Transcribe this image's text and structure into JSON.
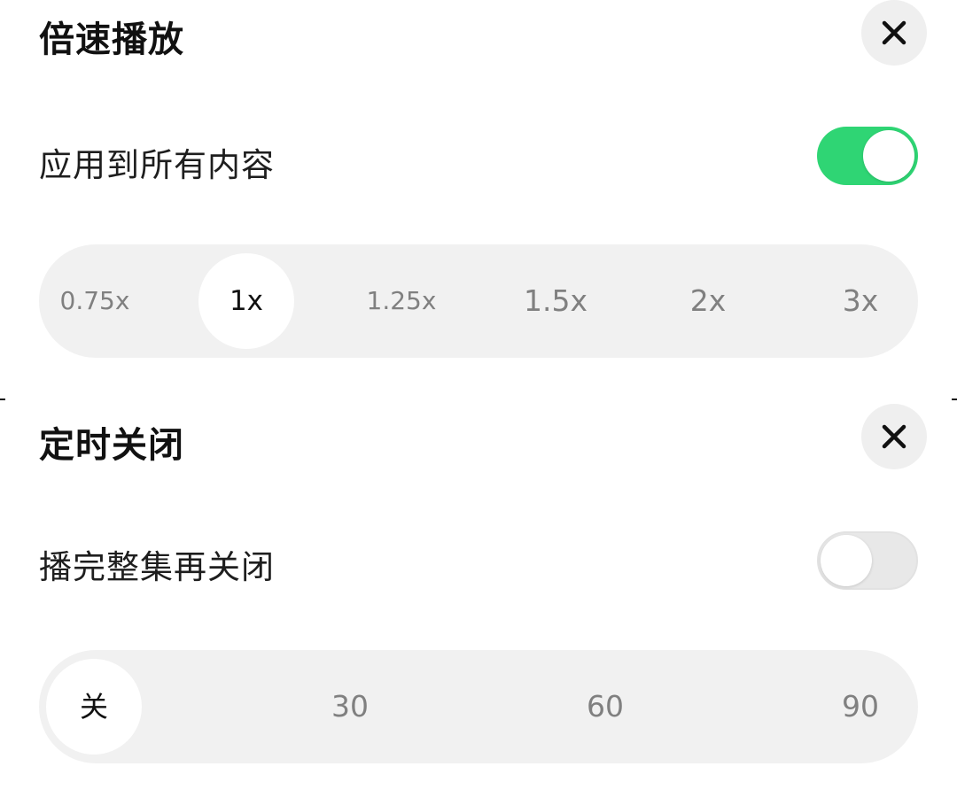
{
  "speed_panel": {
    "title": "倍速播放",
    "apply_all_label": "应用到所有内容",
    "apply_all_enabled": true,
    "options": [
      {
        "label": "0.75x",
        "active": false
      },
      {
        "label": "1x",
        "active": true
      },
      {
        "label": "1.25x",
        "active": false
      },
      {
        "label": "1.5x",
        "active": false
      },
      {
        "label": "2x",
        "active": false
      },
      {
        "label": "3x",
        "active": false
      }
    ]
  },
  "timer_panel": {
    "title": "定时关闭",
    "finish_episode_label": "播完整集再关闭",
    "finish_episode_enabled": false,
    "options": [
      {
        "label": "关",
        "active": true
      },
      {
        "label": "30",
        "active": false
      },
      {
        "label": "60",
        "active": false
      },
      {
        "label": "90",
        "active": false
      }
    ]
  },
  "icons": {
    "close": "close-icon"
  },
  "colors": {
    "toggle_on": "#2fd574",
    "toggle_off": "#e8e8e8",
    "segment_bg": "#f1f1f1",
    "close_bg": "#efefef"
  }
}
